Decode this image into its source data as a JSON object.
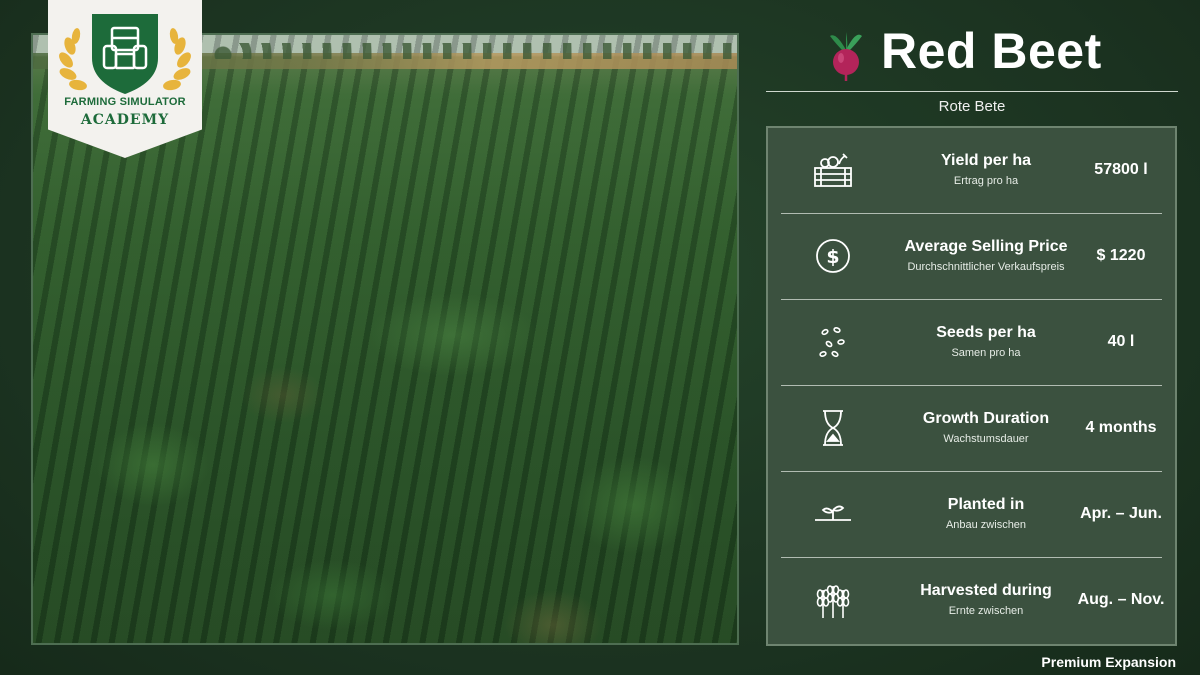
{
  "badge": {
    "line1": "FARMING SIMULATOR",
    "line2": "ACADEMY"
  },
  "title": "Red Beet",
  "subtitle": "Rote Bete",
  "rows": [
    {
      "icon": "crate-icon",
      "label": "Yield per ha",
      "sublabel": "Ertrag pro ha",
      "value": "57800 l"
    },
    {
      "icon": "dollar-coin-icon",
      "label": "Average Selling Price",
      "sublabel": "Durchschnittlicher Verkaufspreis",
      "value": "$ 1220"
    },
    {
      "icon": "seeds-icon",
      "label": "Seeds per ha",
      "sublabel": "Samen pro ha",
      "value": "40 l"
    },
    {
      "icon": "hourglass-icon",
      "label": "Growth Duration",
      "sublabel": "Wachstumsdauer",
      "value": "4 months"
    },
    {
      "icon": "sprout-icon",
      "label": "Planted in",
      "sublabel": "Anbau zwischen",
      "value": "Apr. – Jun."
    },
    {
      "icon": "wheat-icon",
      "label": "Harvested during",
      "sublabel": "Ernte zwischen",
      "value": "Aug. – Nov."
    }
  ],
  "footer": "Premium Expansion",
  "colors": {
    "background": "#1f3a24",
    "panel": "#3b513f",
    "brand_green": "#1d6b3a",
    "badge_gold": "#e7b43c",
    "beet_red": "#b3245a"
  }
}
